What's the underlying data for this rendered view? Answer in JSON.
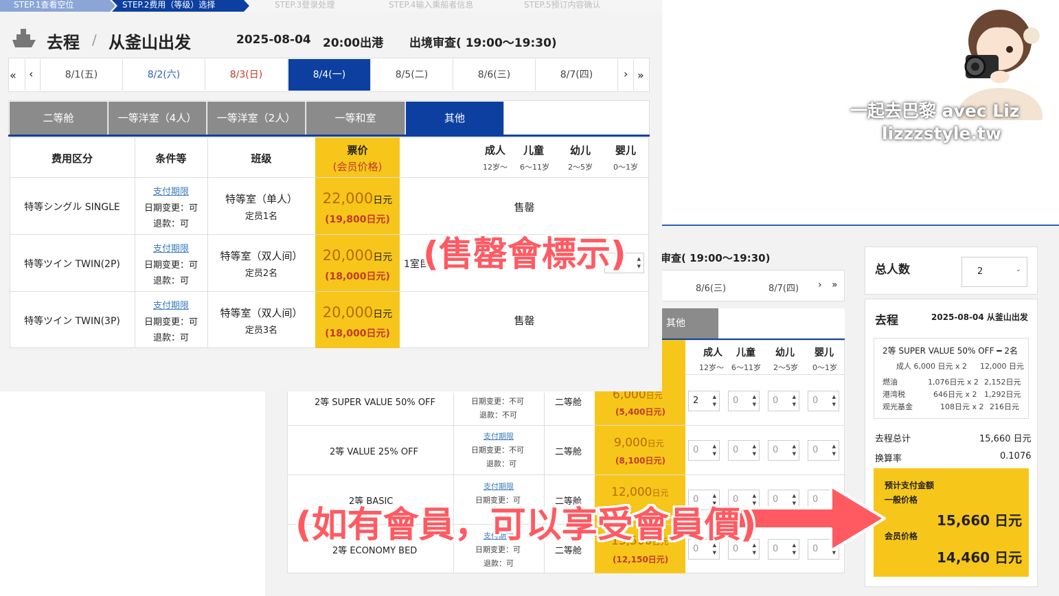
{
  "steps": [
    "STEP.1查看空位",
    "STEP.2费用（等级）选择",
    "STEP.3登录处理",
    "STEP.4输入乘船者信息",
    "STEP.5预订内容确认"
  ],
  "trip": {
    "direction": "去程",
    "separator": "/",
    "origin": "从釜山出发",
    "date": "2025-08-04",
    "departure": "20:00出港",
    "immigration": "出境审查( 19:00～19:30)"
  },
  "dates": [
    "8/1(五)",
    "8/2(六)",
    "8/3(日)",
    "8/4(一)",
    "8/5(二)",
    "8/6(三)",
    "8/7(四)"
  ],
  "nav": {
    "first": "«",
    "prev": "‹",
    "next": "›",
    "last": "»"
  },
  "cabin_tabs": [
    "二等舱",
    "一等洋室（4人）",
    "一等洋室（2人）",
    "一等和室",
    "其他"
  ],
  "table_headers": {
    "fee": "费用区分",
    "condition": "条件等",
    "class": "班级",
    "price": "票价",
    "price_member": "(会员价格)",
    "adult": "成人",
    "adult_age": "12岁～",
    "child": "儿童",
    "child_age": "6～11岁",
    "infant": "幼儿",
    "infant_age": "2～5岁",
    "baby": "婴儿",
    "baby_age": "0～1岁"
  },
  "rows_top": [
    {
      "fee": "特等シングル SINGLE",
      "link": "支付期限",
      "change": "日期变更：可",
      "refund": "退款：可",
      "cls": "特等室（单人）",
      "cap": "定员1名",
      "price": "22,000",
      "unit": "日元",
      "member": "(19,800日元)",
      "status": "售罄"
    },
    {
      "fee": "特等ツイン TWIN(2P)",
      "link": "支付期限",
      "change": "日期变更：可",
      "refund": "退款：可",
      "cls": "特等室（双人间）",
      "cap": "定员2名",
      "price": "20,000",
      "unit": "日元",
      "member": "(18,000日元)",
      "status": "1室目"
    },
    {
      "fee": "特等ツイン TWIN(3P)",
      "link": "支付期限",
      "change": "日期变更：可",
      "refund": "退款：可",
      "cls": "特等室（双人间）",
      "cap": "定员3名",
      "price": "20,000",
      "unit": "日元",
      "member": "(18,000日元)",
      "status": "售罄"
    }
  ],
  "rows_bottom": [
    {
      "fee": "2等 SUPER VALUE 50% OFF",
      "link": "",
      "change": "日期变更：不可",
      "refund": "退款：不可",
      "cls": "二等舱",
      "price": "6,000",
      "unit": "日元",
      "member": "(5,400日元)",
      "adult": "2",
      "child": "0",
      "infant": "0",
      "baby": "0"
    },
    {
      "fee": "2等 VALUE 25% OFF",
      "link": "支付期限",
      "change": "日期变更：不可",
      "refund": "退款：可",
      "cls": "二等舱",
      "price": "9,000",
      "unit": "日元",
      "member": "(8,100日元)",
      "adult": "0",
      "child": "0",
      "infant": "0",
      "baby": "0"
    },
    {
      "fee": "2等 BASIC",
      "link": "支付期限",
      "change": "日期变更：可",
      "refund": "退款：可",
      "cls": "二等舱",
      "price": "12,000",
      "unit": "日元",
      "member": "",
      "adult": "0",
      "child": "0",
      "infant": "0",
      "baby": "0"
    },
    {
      "fee": "2等 ECONOMY BED",
      "link": "支付期限",
      "change": "日期变更：可",
      "refund": "退款：可",
      "cls": "二等舱",
      "price": "13,500",
      "unit": "日元",
      "member": "(12,150日元)",
      "adult": "0",
      "child": "0",
      "infant": "0",
      "baby": "0"
    }
  ],
  "panel2": {
    "immigration": "审查( 19:00～19:30)",
    "dates": [
      "8/6(三)",
      "8/7(四)"
    ],
    "tab_other": "其他"
  },
  "summary": {
    "total_label": "总人数",
    "total_value": "2",
    "direction": "去程",
    "date_origin": "2025-08-04 从釜山出发",
    "item": "2等 SUPER VALUE 50% OFF",
    "item_count": "2名",
    "adult_line": "成人 6,000 日元 x 2",
    "adult_total": "12,000 日元",
    "fees": [
      {
        "label": "燃油",
        "calc": "1,076日元 x 2",
        "total": "2,152日元"
      },
      {
        "label": "港湾税",
        "calc": "646日元 x 2",
        "total": "1,292日元"
      },
      {
        "label": "观光基金",
        "calc": "108日元 x 2",
        "total": "216日元"
      }
    ],
    "trip_total_label": "去程总计",
    "trip_total": "15,660 日元",
    "rate_label": "换算率",
    "rate": "0.1076",
    "pay_label": "预计支付金额",
    "general_label": "一般价格",
    "general_price": "15,660 日元",
    "member_label": "会员价格",
    "member_price": "14,460 日元"
  },
  "overlays": {
    "soldout_note": "(售罄會標示)",
    "member_note": "(如有會員，可以享受會員價)"
  },
  "watermark": {
    "line1": "一起去巴黎 avec Liz",
    "line2": "lizzzstyle.tw"
  },
  "colors": {
    "accent_blue": "#0d3fa0",
    "price_yellow": "#f7c61a",
    "tab_gray": "#8b8b8b",
    "sunday_red": "#c0392b",
    "saturday_blue": "#2a5fb8",
    "arrow_red": "#ff5a62"
  }
}
